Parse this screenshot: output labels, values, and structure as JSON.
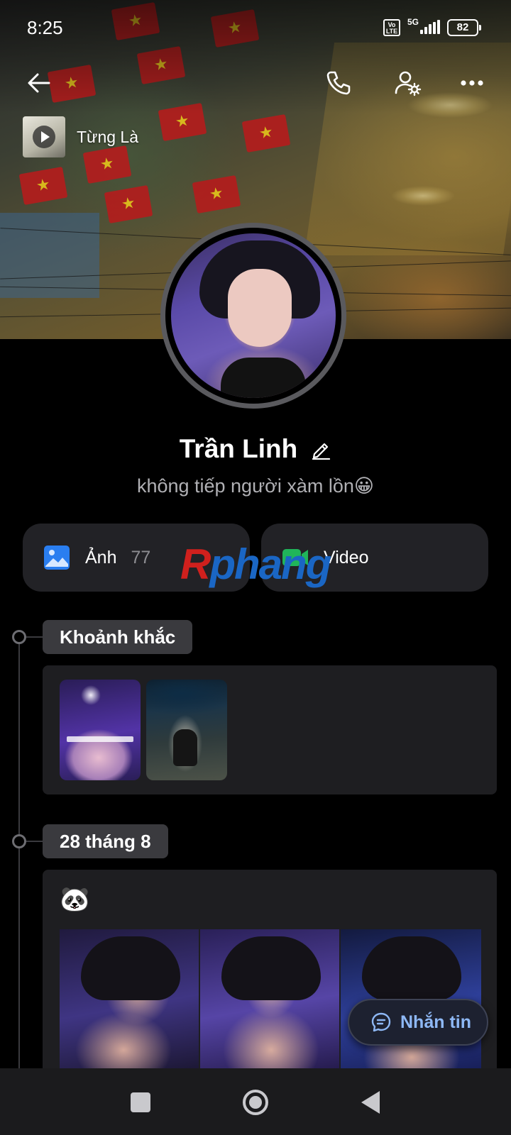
{
  "status_bar": {
    "time": "8:25",
    "volte": "Vo LTE",
    "network": "5G",
    "battery": "82"
  },
  "top_nav": {
    "back_icon": "arrow-left-icon",
    "call_icon": "phone-icon",
    "settings_icon": "user-settings-icon",
    "more_icon": "more-dots-icon"
  },
  "music": {
    "title": "Từng Là"
  },
  "profile": {
    "name": "Trần Linh",
    "bio": "không tiếp người xàm lồn😀"
  },
  "media": {
    "photos_label": "Ảnh",
    "photos_count": "77",
    "videos_label": "Video",
    "photos_color": "#2a7ef0",
    "videos_color": "#20b55a"
  },
  "watermark": {
    "part1": "R",
    "part2": "phang"
  },
  "timeline": [
    {
      "label": "Khoảnh khắc"
    },
    {
      "label": "28 tháng 8",
      "emoji": "🐼"
    }
  ],
  "message_button": {
    "label": "Nhắn tin",
    "accent": "#8eb8f5"
  }
}
